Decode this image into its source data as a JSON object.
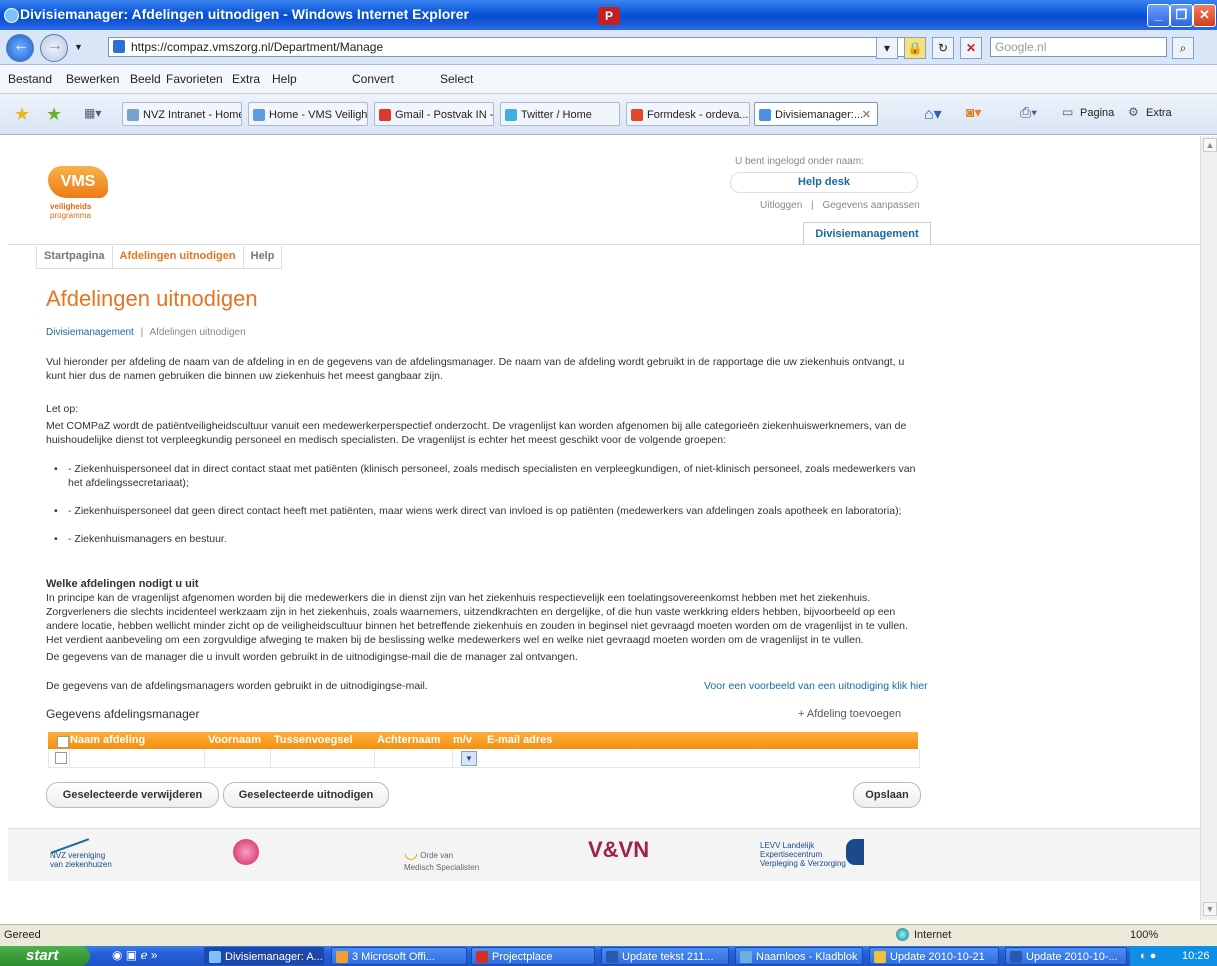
{
  "window": {
    "title": "Divisiemanager: Afdelingen uitnodigen - Windows Internet Explorer"
  },
  "address": {
    "url": "https://compaz.vmszorg.nl/Department/Manage",
    "search_placeholder": "Google.nl"
  },
  "menu": [
    "Bestand",
    "Bewerken",
    "Beeld",
    "Favorieten",
    "Extra",
    "Help"
  ],
  "menu_extra": {
    "convert": "Convert",
    "select": "Select"
  },
  "tabs": [
    "NVZ Intranet - Home",
    "Home - VMS Veiligh...",
    "Gmail - Postvak IN -...",
    "Twitter / Home",
    "Formdesk - ordeva...",
    "Divisiemanager:..."
  ],
  "toolbar": {
    "pagina": "Pagina",
    "extra": "Extra"
  },
  "site": {
    "logo_text": "VMS",
    "logo_sub1": "veiligheids",
    "logo_sub2": "programma",
    "logged_in_label": "U bent ingelogd onder naam:",
    "user_name": "Help desk",
    "logout": "Uitloggen",
    "separator": "|",
    "edit_details": "Gegevens aanpassen",
    "section_tab": "Divisiemanagement"
  },
  "nav": [
    "Startpagina",
    "Afdelingen uitnodigen",
    "Help"
  ],
  "page": {
    "title": "Afdelingen uitnodigen",
    "breadcrumb": {
      "root": "Divisiemanagement",
      "current": "Afdelingen uitnodigen"
    },
    "intro": "Vul hieronder per afdeling de naam van de afdeling in en de gegevens van de afdelingsmanager. De naam van de afdeling wordt gebruikt in de rapportage die uw ziekenhuis ontvangt, u kunt hier dus de namen gebruiken die binnen uw ziekenhuis het meest gangbaar zijn.",
    "let_op": "Let op:",
    "compaz_text": "Met COMPaZ wordt de patiëntveiligheidscultuur vanuit een medewerkerperspectief onderzocht. De vragenlijst kan worden afgenomen bij alle categorieën ziekenhuiswerknemers, van de huishoudelijke dienst tot verpleegkundig personeel en medisch specialisten. De vragenlijst is echter het meest geschikt voor de volgende groepen:",
    "bullets": [
      "- Ziekenhuispersoneel dat in direct contact staat met patiënten (klinisch personeel, zoals medisch specialisten en verpleegkundigen, of niet-klinisch personeel, zoals medewerkers van het afdelingssecretariaat);",
      "- Ziekenhuispersoneel dat geen direct contact heeft met patiënten, maar wiens werk direct van invloed is op patiënten (medewerkers van afdelingen zoals apotheek en laboratoria);",
      "- Ziekenhuismanagers en bestuur."
    ],
    "welke_heading": "Welke afdelingen nodigt u uit",
    "welke_text": "In principe kan de vragenlijst afgenomen worden bij die medewerkers die in dienst zijn van het ziekenhuis respectievelijk een toelatingsovereenkomst hebben met het ziekenhuis. Zorgverleners die slechts incidenteel werkzaam zijn in het ziekenhuis, zoals waarnemers, uitzendkrachten en dergelijke, of die hun vaste werkkring elders hebben, bijvoorbeeld op een andere locatie, hebben wellicht minder zicht op de veiligheidscultuur binnen het betreffende ziekenhuis en zouden in beginsel niet gevraagd moeten worden om de vragenlijst in te vullen. Het verdient aanbeveling om een zorgvuldige afweging te maken bij de beslissing welke medewerkers wel en welke niet gevraagd moeten worden om de vragenlijst in te vullen.",
    "manager_text": "De gegevens van de manager die u invult worden gebruikt in de uitnodigingse-mail die de manager zal ontvangen.",
    "managers_note": "De gegevens van de afdelingsmanagers worden gebruikt in de uitnodigingse-mail.",
    "example_link": "Voor een voorbeeld van een uitnodiging klik hier",
    "gegevens_heading": "Gegevens afdelingsmanager",
    "add_department": "+ Afdeling toevoegen",
    "table_columns": [
      "Naam afdeling",
      "Voornaam",
      "Tussenvoegsel",
      "Achternaam",
      "m/v",
      "E-mail adres"
    ],
    "buttons": {
      "delete_selected": "Geselecteerde verwijderen",
      "invite_selected": "Geselecteerde uitnodigen",
      "save": "Opslaan"
    }
  },
  "footer_logos": [
    "NVZ vereniging van ziekenhuizen",
    "V&VN",
    "Orde van Medisch Specialisten",
    "LEVV Landelijk Expertisecentrum Verpleging & Verzorging"
  ],
  "status": {
    "text": "Gereed",
    "zone": "Internet",
    "zoom": "100%"
  },
  "taskbar": {
    "start": "start",
    "items": [
      "Divisiemanager: A...",
      "3 Microsoft Offi...",
      "Projectplace",
      "Update tekst 211...",
      "Naamloos - Kladblok",
      "Update 2010-10-21",
      "Update 2010-10-..."
    ],
    "clock": "10:26"
  }
}
